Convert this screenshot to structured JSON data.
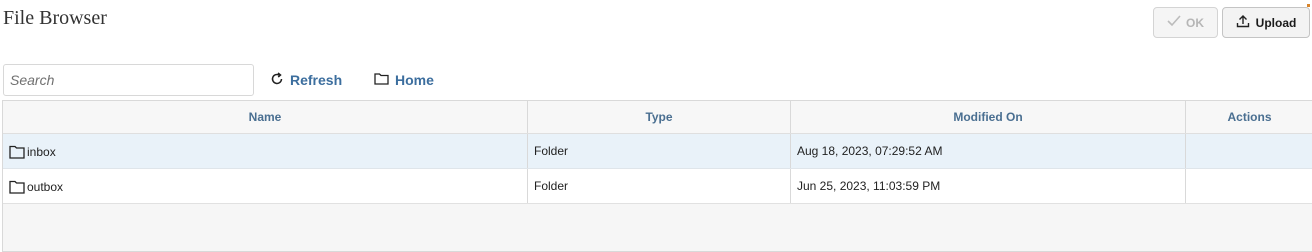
{
  "header": {
    "title": "File Browser",
    "ok_label": "OK",
    "upload_label": "Upload"
  },
  "toolbar": {
    "search_placeholder": "Search",
    "refresh_label": "Refresh",
    "home_label": "Home"
  },
  "table": {
    "columns": [
      "Name",
      "Type",
      "Modified On",
      "Actions"
    ],
    "rows": [
      {
        "name": "inbox",
        "type": "Folder",
        "modified": "Aug 18, 2023, 07:29:52 AM",
        "actions": "",
        "selected": true
      },
      {
        "name": "outbox",
        "type": "Folder",
        "modified": "Jun 25, 2023, 11:03:59 PM",
        "actions": "",
        "selected": false
      }
    ]
  },
  "icons": {
    "ok": "checkmark-icon",
    "upload": "upload-icon",
    "refresh": "refresh-icon",
    "home": "folder-icon",
    "row": "folder-icon"
  },
  "colors": {
    "link": "#3c6e9e",
    "header_text": "#4a6f91",
    "selected_row": "#e9f2f9",
    "disabled_text": "#b6b6b6"
  }
}
